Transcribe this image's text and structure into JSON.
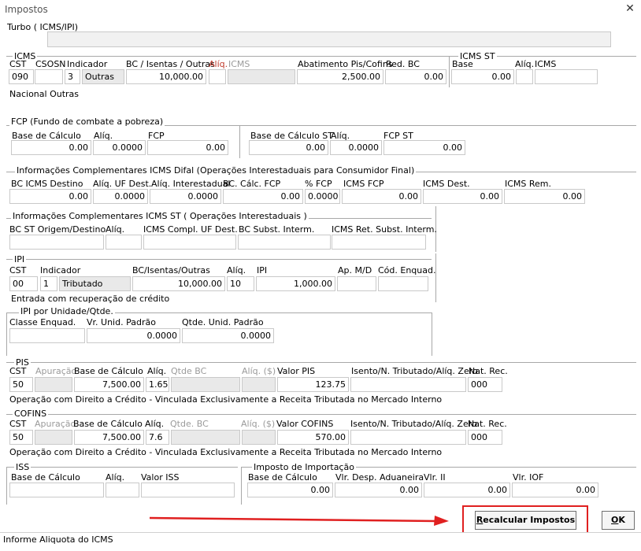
{
  "window": {
    "title": "Impostos",
    "close_glyph": "✕"
  },
  "turbo": {
    "label": "Turbo ( ICMS/IPI)"
  },
  "icms": {
    "section": "ICMS",
    "cst_label": "CST",
    "csosn_label": "CSOSN",
    "indicador_label": "Indicador",
    "bc_label": "BC / Isentas / Outras",
    "aliq_label": "Alíq.",
    "icms_label": "ICMS",
    "abat_label": "Abatimento Pis/Cofins",
    "redbc_label": "Red. BC",
    "cst": "090",
    "csosn": "",
    "indicador_num": "3",
    "indicador_text": "Outras",
    "bc": "10,000.00",
    "aliq": "",
    "icms": "",
    "abat": "2,500.00",
    "redbc": "0.00",
    "desc": "Nacional Outras",
    "st_section": "ICMS ST",
    "st_base_label": "Base",
    "st_aliq_label": "Alíq.",
    "st_icms_label": "ICMS",
    "st_base": "0.00",
    "st_aliq": "",
    "st_icms": ""
  },
  "fcp": {
    "section": "FCP (Fundo de combate a pobreza)",
    "base_label": "Base de Cálculo",
    "aliq_label": "Alíq.",
    "fcp_label": "FCP",
    "base": "0.00",
    "aliq": "0.0000",
    "fcp": "0.00",
    "st_base_label": "Base de Cálculo ST",
    "st_aliq_label": "Alíq.",
    "st_fcp_label": "FCP ST",
    "st_base": "0.00",
    "st_aliq": "0.0000",
    "st_fcp": "0.00"
  },
  "difal": {
    "section": "Informações Complementares ICMS Difal (Operações Interestaduais para Consumidor Final)",
    "bc_dest_label": "BC ICMS Destino",
    "aliq_uf_label": "Alíq. UF Dest.",
    "aliq_inter_label": "Alíq. Interestadual",
    "bc_fcp_label": "BC. Cálc. FCP",
    "pfcp_label": "% FCP",
    "icms_fcp_label": "ICMS FCP",
    "icms_dest_label": "ICMS Dest.",
    "icms_rem_label": "ICMS Rem.",
    "bc_dest": "0.00",
    "aliq_uf": "0.0000",
    "aliq_inter": "0.0000",
    "bc_fcp": "0.00",
    "pfcp": "0.0000",
    "icms_fcp": "0.00",
    "icms_dest": "0.00",
    "icms_rem": "0.00"
  },
  "st_inter": {
    "section": "Informações Complementares ICMS ST ( Operações Interestaduais )",
    "bc_st_label": "BC ST Origem/Destino",
    "aliq_label": "Alíq.",
    "compl_label": "ICMS Compl. UF Dest.",
    "bc_subst_label": "BC  Subst. Interm.",
    "ret_label": "ICMS Ret. Subst. Interm."
  },
  "ipi": {
    "section": "IPI",
    "cst_label": "CST",
    "indicador_label": "Indicador",
    "bc_label": "BC/Isentas/Outras",
    "aliq_label": "Alíq.",
    "ipi_label": "IPI",
    "apmd_label": "Ap. M/D",
    "cod_label": "Cód. Enquad.",
    "cst": "00",
    "indicador_num": "1",
    "indicador_text": "Tributado",
    "bc": "10,000.00",
    "aliq": "10",
    "ipi": "1,000.00",
    "apmd": "",
    "cod": "",
    "desc": "Entrada com recuperação de crédito"
  },
  "ipi_unid": {
    "section": "IPI por Unidade/Qtde.",
    "classe_label": "Classe Enquad.",
    "vr_label": "Vr. Unid. Padrão",
    "qtde_label": "Qtde. Unid. Padrão",
    "classe": "",
    "vr": "0.0000",
    "qtde": "0.0000"
  },
  "pis": {
    "section": "PIS",
    "cst_label": "CST",
    "apuracao_label": "Apuração",
    "base_label": "Base de Cálculo",
    "aliq_label": "Alíq.",
    "qtde_label": "Qtde BC",
    "aliq_rs_label": "Alíq. ($)",
    "valor_label": "Valor PIS",
    "isento_label": "Isento/N. Tributado/Alíq. Zero",
    "nat_label": "Nat. Rec.",
    "cst": "50",
    "base": "7,500.00",
    "aliq": "1.65",
    "valor": "123.75",
    "nat": "000",
    "desc": "Operação com Direito a Crédito - Vinculada Exclusivamente a Receita Tributada no Mercado Interno"
  },
  "cofins": {
    "section": "COFINS",
    "cst_label": "CST",
    "apuracao_label": "Apuração",
    "base_label": "Base de Cálculo",
    "aliq_label": "Alíq.",
    "qtde_label": "Qtde. BC",
    "aliq_rs_label": "Alíq. ($)",
    "valor_label": "Valor COFINS",
    "isento_label": "Isento/N. Tributado/Alíq. Zero",
    "nat_label": "Nat. Rec.",
    "cst": "50",
    "base": "7,500.00",
    "aliq": "7.6",
    "valor": "570.00",
    "nat": "000",
    "desc": "Operação com Direito a Crédito - Vinculada Exclusivamente a Receita Tributada no Mercado Interno"
  },
  "iss": {
    "section": "ISS",
    "base_label": "Base de Cálculo",
    "aliq_label": "Alíq.",
    "valor_label": "Valor ISS"
  },
  "import": {
    "section": "Imposto de Importação",
    "base_label": "Base de Cálculo",
    "desp_label": "Vlr. Desp. Aduaneira",
    "ii_label": "Vlr. II",
    "iof_label": "Vlr. IOF",
    "base": "0.00",
    "desp": "0.00",
    "ii": "0.00",
    "iof": "0.00"
  },
  "buttons": {
    "recalc_first": "R",
    "recalc_rest": "ecalcular Impostos",
    "ok_first": "O",
    "ok_rest": "K"
  },
  "status": {
    "text": "Informe Aliquota do ICMS"
  },
  "colors": {
    "highlight": "#e02020"
  }
}
